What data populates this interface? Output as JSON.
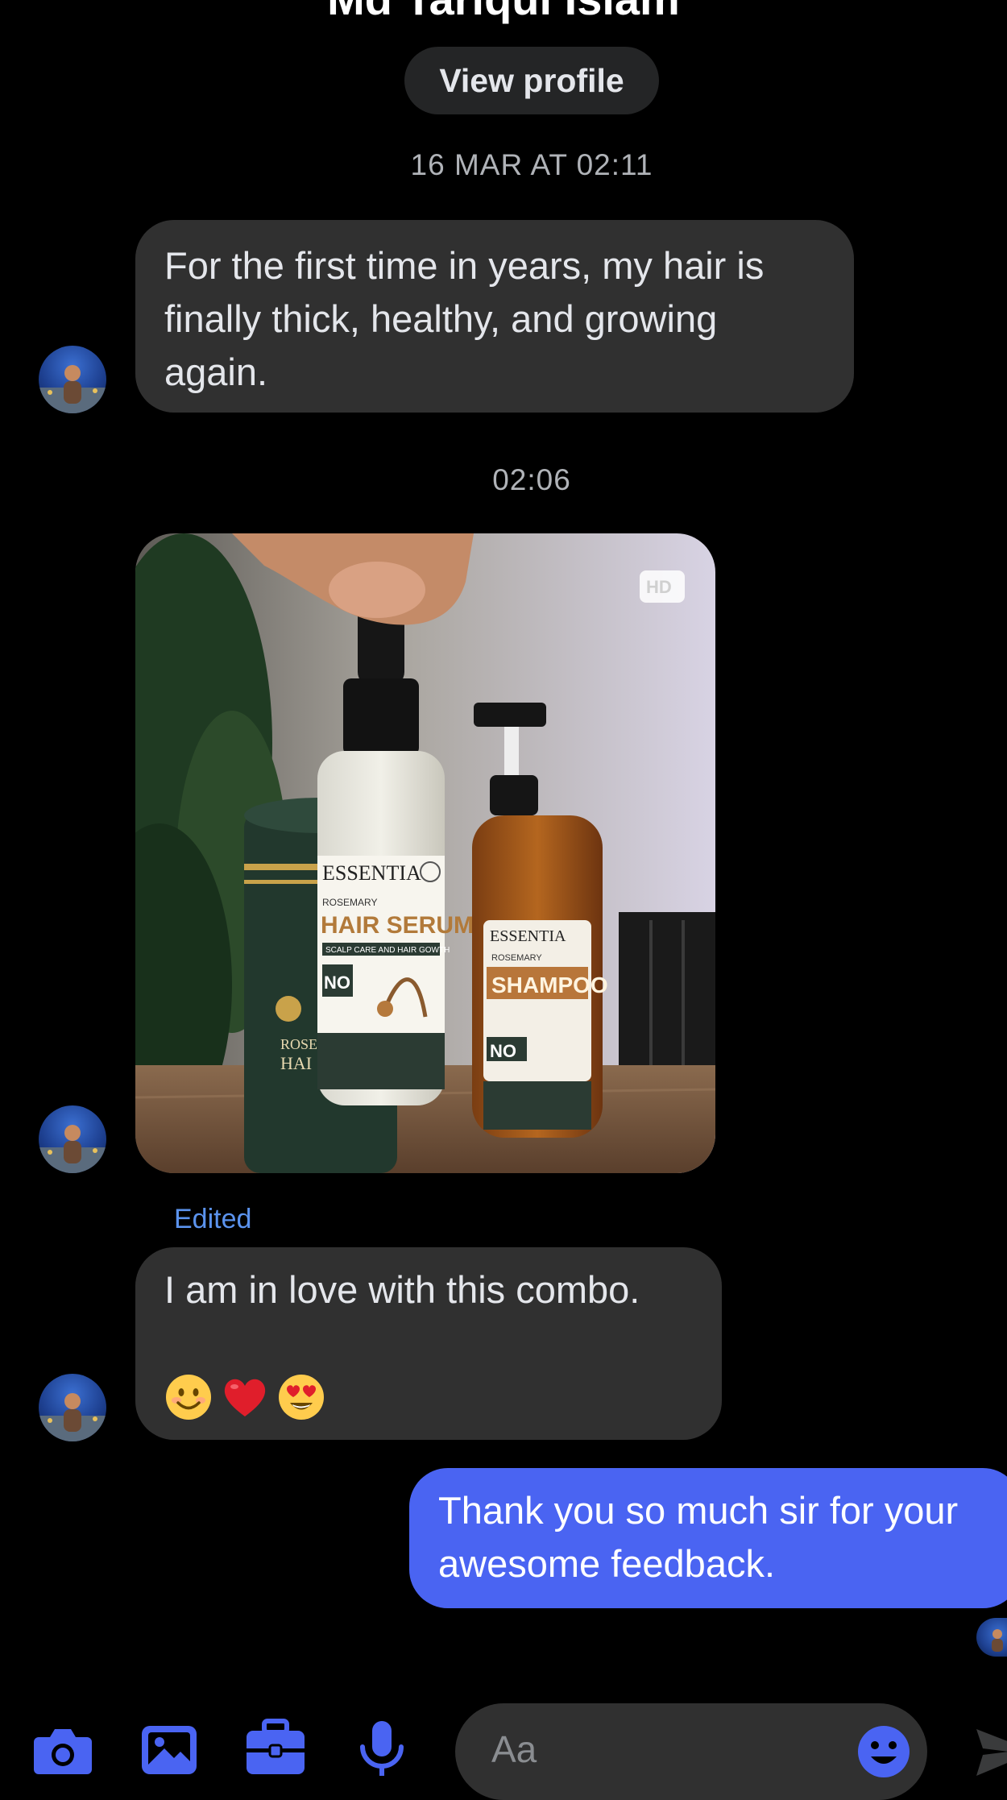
{
  "header": {
    "contact_name": "Md Tariqul Islam",
    "view_profile_label": "View profile"
  },
  "conversation": {
    "timestamp_1": "16 MAR AT 02:11",
    "message_1": "For the first time in years, my hair is finally thick, healthy, and growing again.",
    "timestamp_2": "02:06",
    "photo": {
      "hd_badge": "HD",
      "serum_brand": "ESSENTIA",
      "serum_subtitle": "ROSEMARY",
      "serum_name": "HAIR SERUM",
      "serum_tagline": "SCALP CARE AND HAIR GOWTH",
      "serum_no": "NO",
      "shampoo_brand": "ESSENTIA",
      "shampoo_subtitle": "ROSEMARY",
      "shampoo_name": "SHAMPOO",
      "shampoo_no": "NO"
    },
    "edited_label": "Edited",
    "message_3": "I am in love with this combo.",
    "message_3_emojis": [
      "smiling-face-emoji",
      "red-heart-emoji",
      "heart-eyes-emoji"
    ],
    "reply": "Thank you so much sir for your awesome feedback."
  },
  "composer": {
    "placeholder": "Aa"
  },
  "colors": {
    "background": "#000000",
    "incoming_bubble": "#303030",
    "outgoing_bubble": "#4a64f2",
    "accent": "#4a64f2",
    "edited_label": "#5b93ee"
  }
}
